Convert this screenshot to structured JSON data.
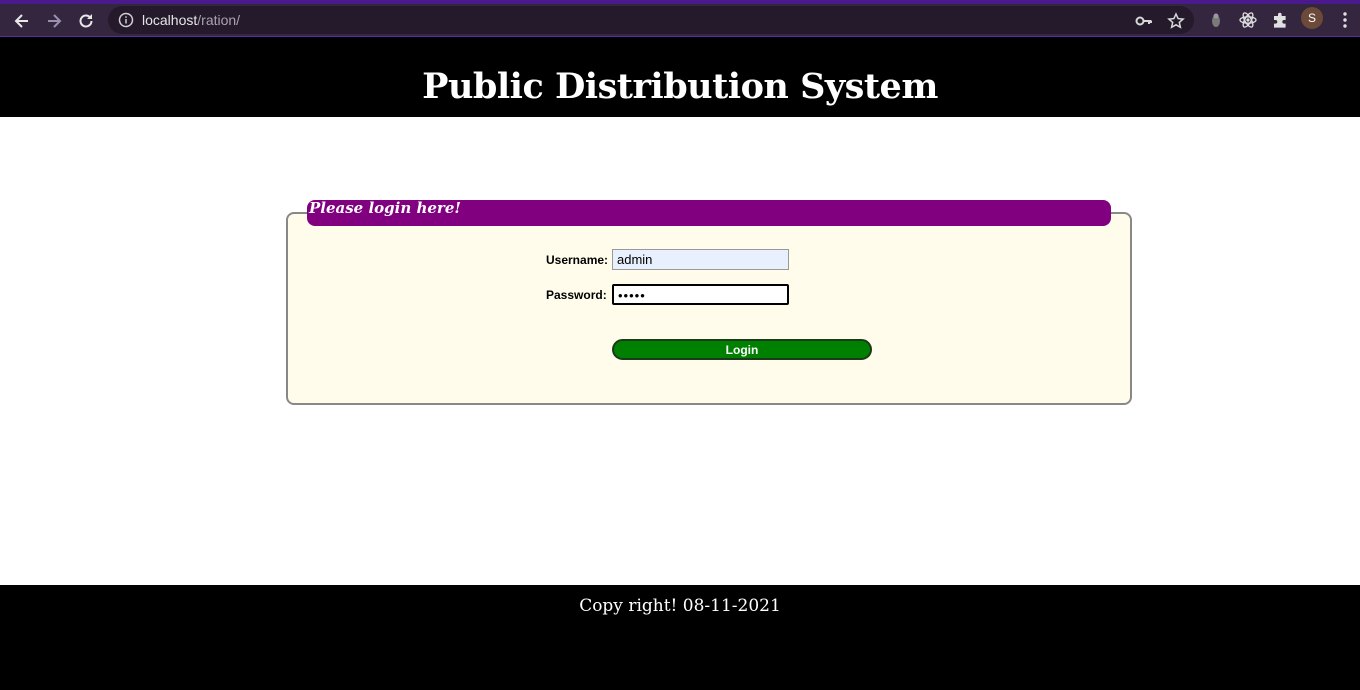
{
  "browser": {
    "url_host": "localhost",
    "url_path": "/ration/",
    "profile_initial": "S",
    "icons": [
      "back-icon",
      "forward-icon",
      "reload-icon",
      "info-icon",
      "key-icon",
      "star-icon",
      "extension-mask-icon",
      "react-icon",
      "puzzle-icon",
      "menu-icon"
    ]
  },
  "header": {
    "title": "Public Distribution System"
  },
  "login": {
    "legend": "Please login here!",
    "username_label": "Username:",
    "username_value": "admin",
    "password_label": "Password:",
    "password_value": "•••••",
    "login_button": "Login"
  },
  "footer": {
    "text": "Copy right! 08-11-2021"
  },
  "colors": {
    "header_bg": "#000000",
    "legend_bg": "#800080",
    "fieldset_bg": "#fffcec",
    "button_bg": "#008000"
  }
}
